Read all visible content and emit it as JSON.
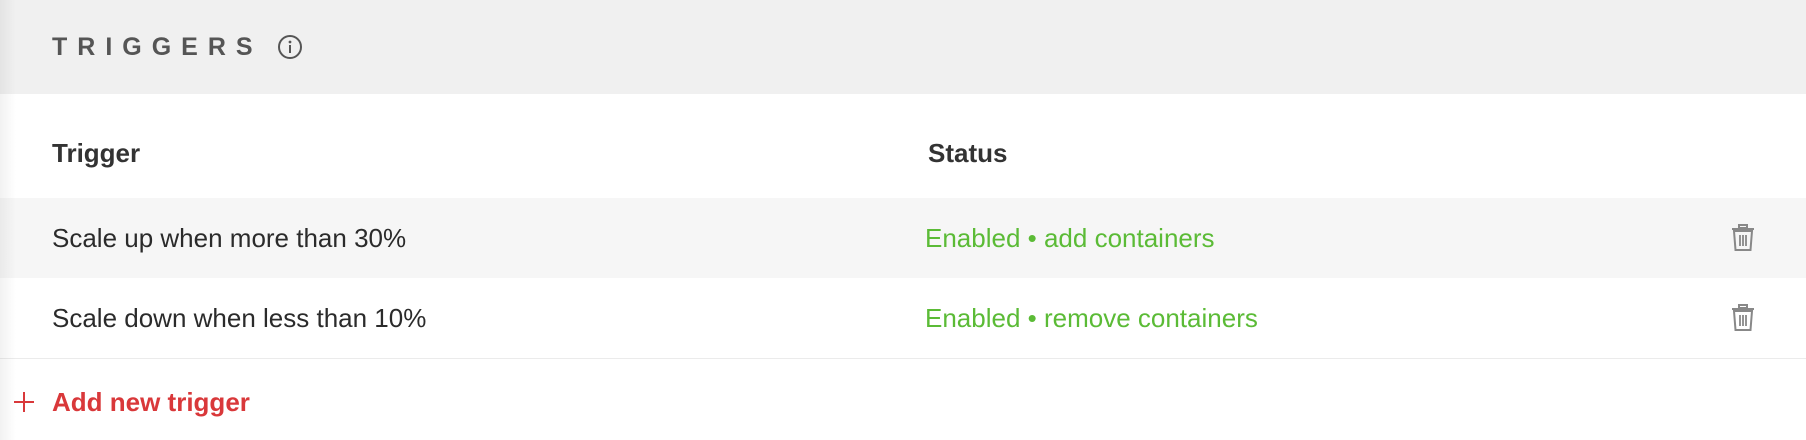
{
  "header": {
    "title": "TRIGGERS",
    "info_icon": "info-icon"
  },
  "table": {
    "columns": [
      "Trigger",
      "Status"
    ],
    "rows": [
      {
        "trigger": "Scale up when more than 30%",
        "status": "Enabled • add containers",
        "action_icon": "trash-icon"
      },
      {
        "trigger": "Scale down when less than 10%",
        "status": "Enabled • remove containers",
        "action_icon": "trash-icon"
      }
    ]
  },
  "add_button": {
    "label": "Add new trigger",
    "icon": "plus-icon"
  },
  "colors": {
    "header_bg": "#f0f0f0",
    "status_green": "#5bbb36",
    "accent_red": "#d9383a",
    "icon_gray": "#888888"
  }
}
